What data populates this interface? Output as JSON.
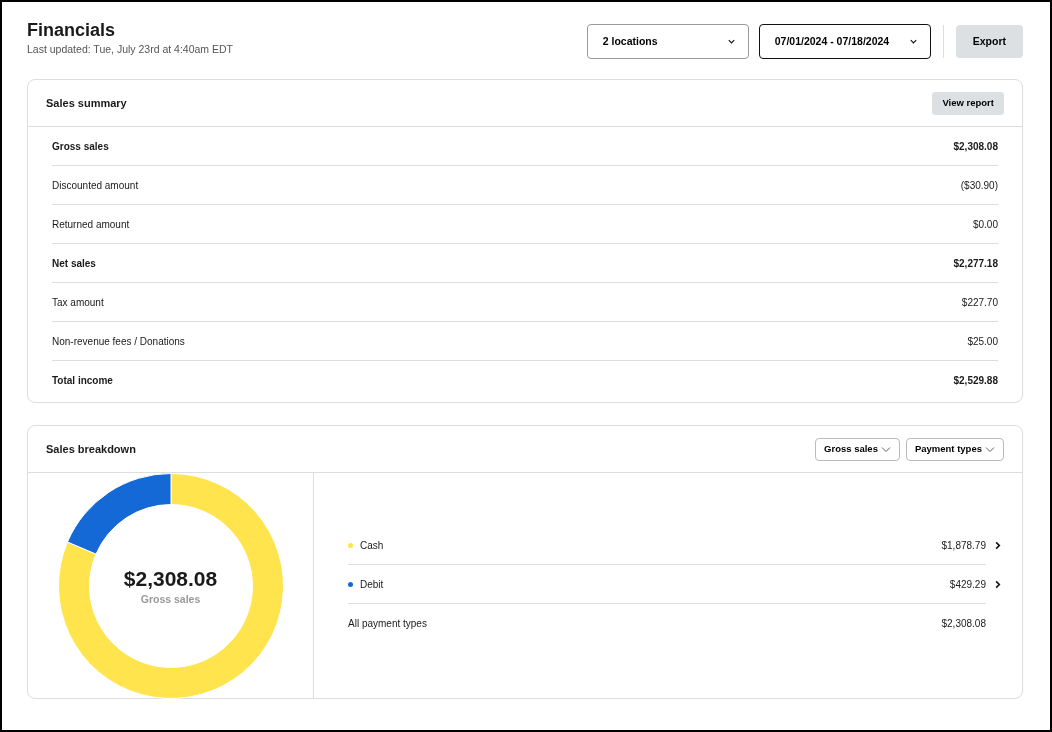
{
  "header": {
    "title": "Financials",
    "subtitle": "Last updated: Tue, July 23rd at 4:40am EDT",
    "location_select": "2 locations",
    "date_range": "07/01/2024 - 07/18/2024",
    "export_button": "Export"
  },
  "sales_summary": {
    "title": "Sales summary",
    "button": "View report",
    "rows": [
      {
        "label": "Gross sales",
        "value": "$2,308.08",
        "kind": "total"
      },
      {
        "label": "Discounted amount",
        "value": "($30.90)",
        "kind": "line"
      },
      {
        "label": "Returned amount",
        "value": "$0.00",
        "kind": "line"
      },
      {
        "label": "Net sales",
        "value": "$2,277.18",
        "kind": "total"
      },
      {
        "label": "Tax amount",
        "value": "$227.70",
        "kind": "line"
      },
      {
        "label": "Non-revenue fees / Donations",
        "value": "$25.00",
        "kind": "line"
      },
      {
        "label": "Total income",
        "value": "$2,529.88",
        "kind": "total"
      }
    ]
  },
  "sales_breakdown": {
    "title": "Sales breakdown",
    "filters": [
      "Gross sales",
      "Payment types"
    ],
    "center_value": "$2,308.08",
    "center_label": "Gross sales",
    "chart_data": {
      "type": "donut",
      "categories": [
        "Cash",
        "Debit"
      ],
      "values": [
        81.4,
        18.6
      ]
    },
    "legend": [
      {
        "value": "$1,878.79",
        "kind": "payment",
        "color": "#ffe44d"
      },
      {
        "value": "$429.29",
        "kind": "payment",
        "color": "#1469d6"
      },
      {
        "label": "All payment types",
        "value": "$2,308.08",
        "kind": "total"
      }
    ]
  }
}
